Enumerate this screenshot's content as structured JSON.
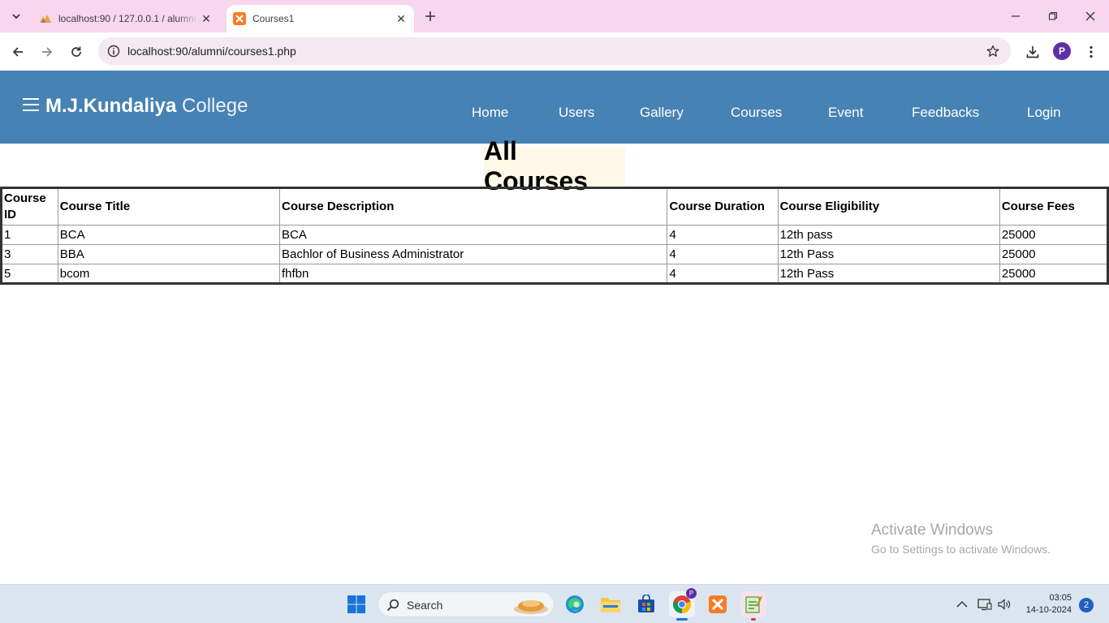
{
  "browser": {
    "tabs": [
      {
        "title": "localhost:90 / 127.0.0.1 / alumni",
        "active": false,
        "favicon": "phpmyadmin-icon"
      },
      {
        "title": "Courses1",
        "active": true,
        "favicon": "xampp-icon"
      }
    ],
    "url": "localhost:90/alumni/courses1.php",
    "profile_initial": "P"
  },
  "site": {
    "brand_strong": "M.J.Kundaliya",
    "brand_light": "College",
    "header_color": "#4682b4",
    "nav": [
      "Home",
      "Users",
      "Gallery",
      "Courses",
      "Event",
      "Feedbacks",
      "Login"
    ]
  },
  "page": {
    "title": "All Courses",
    "table": {
      "headers": [
        "Course ID",
        "Course Title",
        "Course Description",
        "Course Duration",
        "Course Eligibility",
        "Course Fees"
      ],
      "rows": [
        [
          "1",
          "BCA",
          "BCA",
          "4",
          "12th pass",
          "25000"
        ],
        [
          "3",
          "BBA",
          "Bachlor of Business Administrator",
          "4",
          "12th Pass",
          "25000"
        ],
        [
          "5",
          "bcom",
          "fhfbn",
          "4",
          "12th Pass",
          "25000"
        ]
      ]
    }
  },
  "watermark": {
    "line1": "Activate Windows",
    "line2": "Go to Settings to activate Windows."
  },
  "taskbar": {
    "search_label": "Search",
    "time": "03:05",
    "date": "14-10-2024",
    "notification_count": "2",
    "chrome_badge": "P"
  }
}
